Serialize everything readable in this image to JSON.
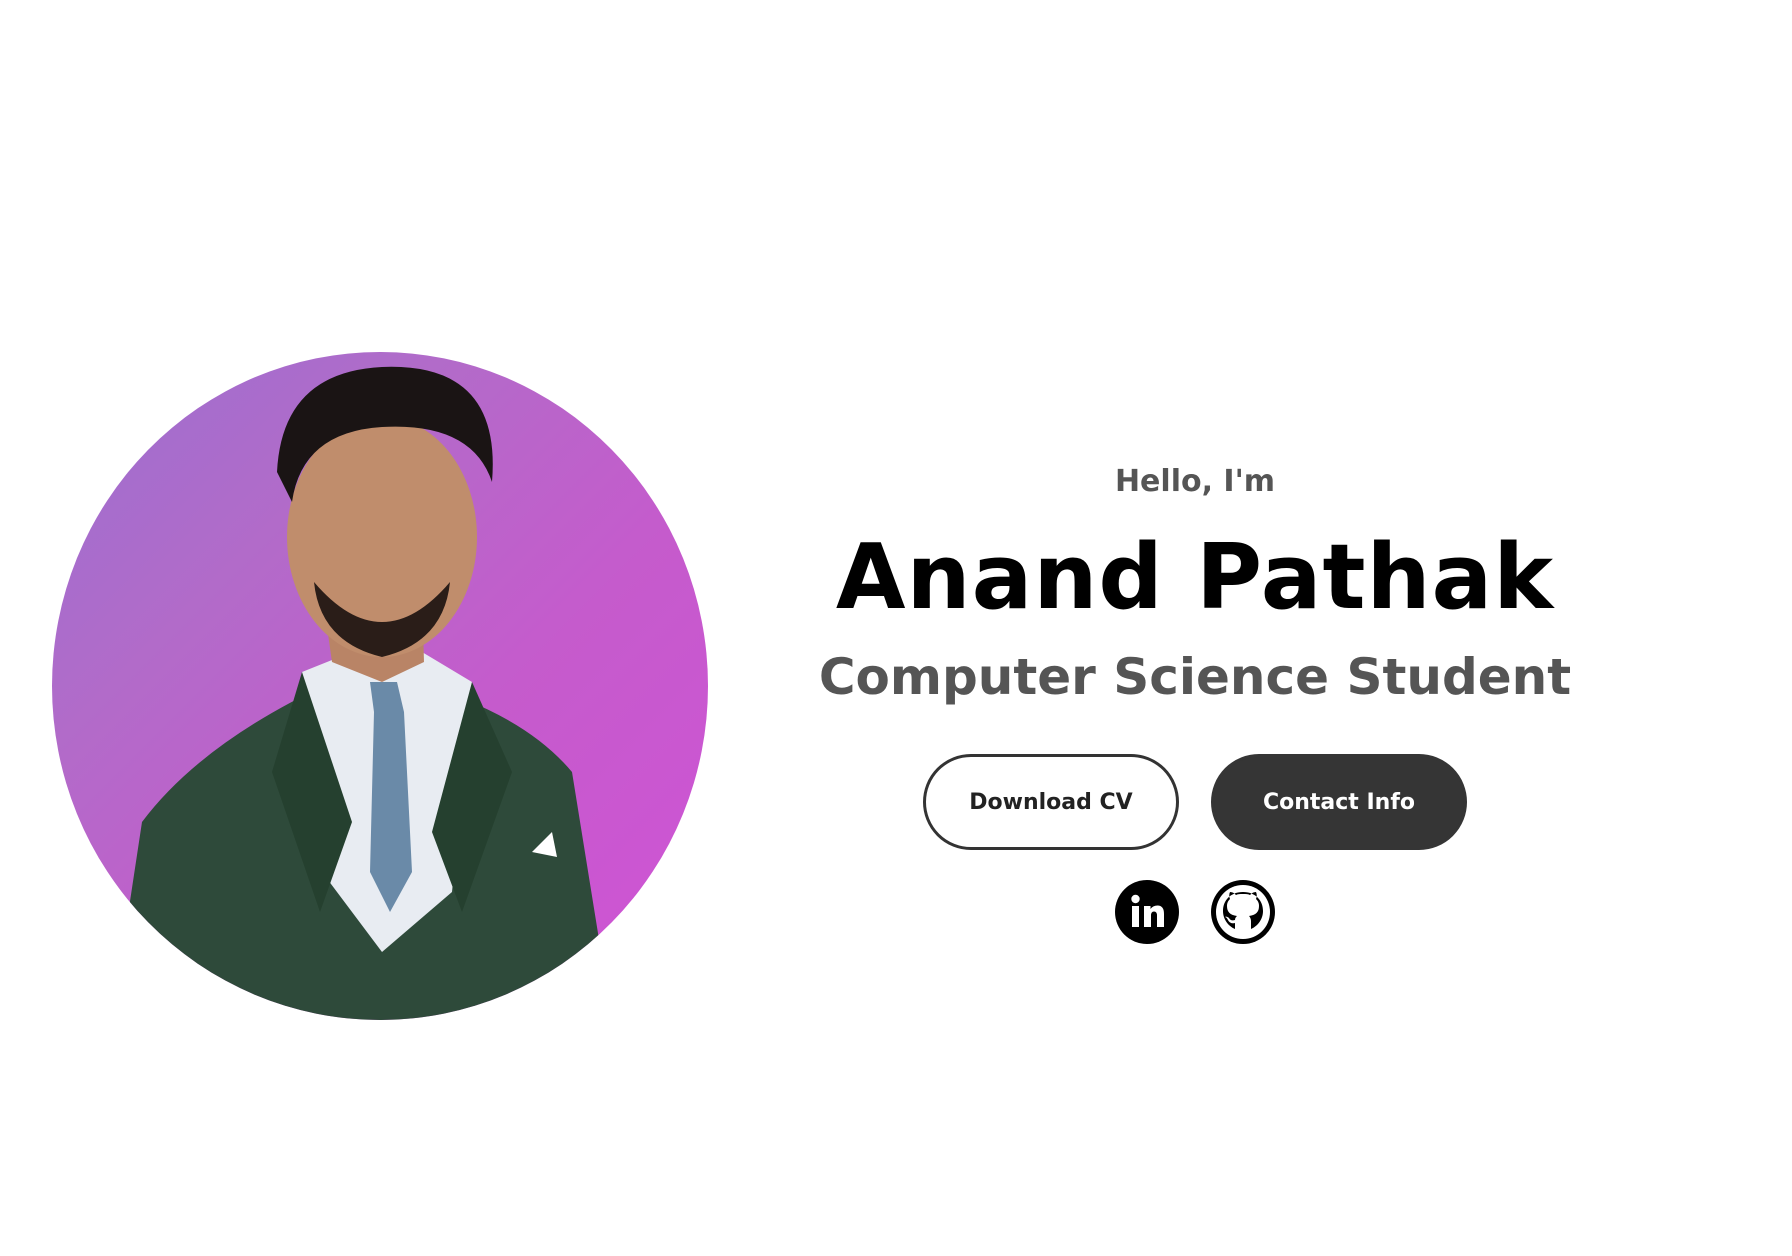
{
  "hero": {
    "greeting": "Hello, I'm",
    "name": "Anand Pathak",
    "role": "Computer Science Student"
  },
  "buttons": {
    "download_cv": "Download CV",
    "contact_info": "Contact Info"
  },
  "socials": [
    {
      "icon": "linkedin-icon"
    },
    {
      "icon": "github-icon"
    }
  ],
  "colors": {
    "button_dark": "#353535",
    "subtitle_gray": "#555555",
    "photo_bg_start": "#9b6fd0",
    "photo_bg_end": "#d052d6"
  }
}
